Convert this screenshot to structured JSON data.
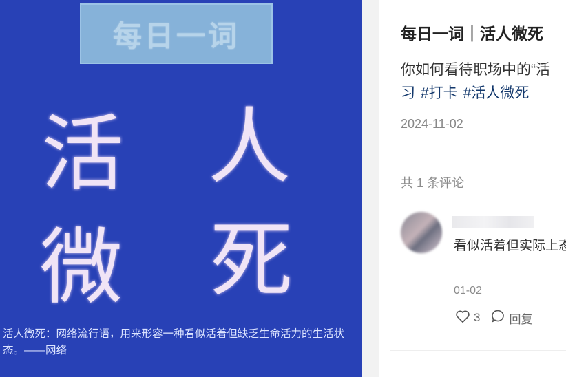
{
  "image": {
    "header": "每日一词",
    "chars": [
      "活",
      "人",
      "微",
      "死"
    ],
    "caption": "活人微死：网络流行语，用来形容一种看似活着但缺乏生命活力的生活状态。——网络"
  },
  "post": {
    "title": "每日一词｜活人微死",
    "description": "你如何看待职场中的“活",
    "tags": [
      "习",
      "#打卡",
      "#活人微死"
    ],
    "date": "2024-11-02"
  },
  "comments": {
    "count_label": "共 1 条评论",
    "items": [
      {
        "text": "看似活着但实际上态",
        "date": "01-02",
        "likes": "3",
        "reply_label": "回复"
      }
    ]
  },
  "colors": {
    "image_bg": "#2841b6",
    "tag_color": "#13386c"
  },
  "icons": [
    "heart-icon",
    "comment-icon"
  ]
}
